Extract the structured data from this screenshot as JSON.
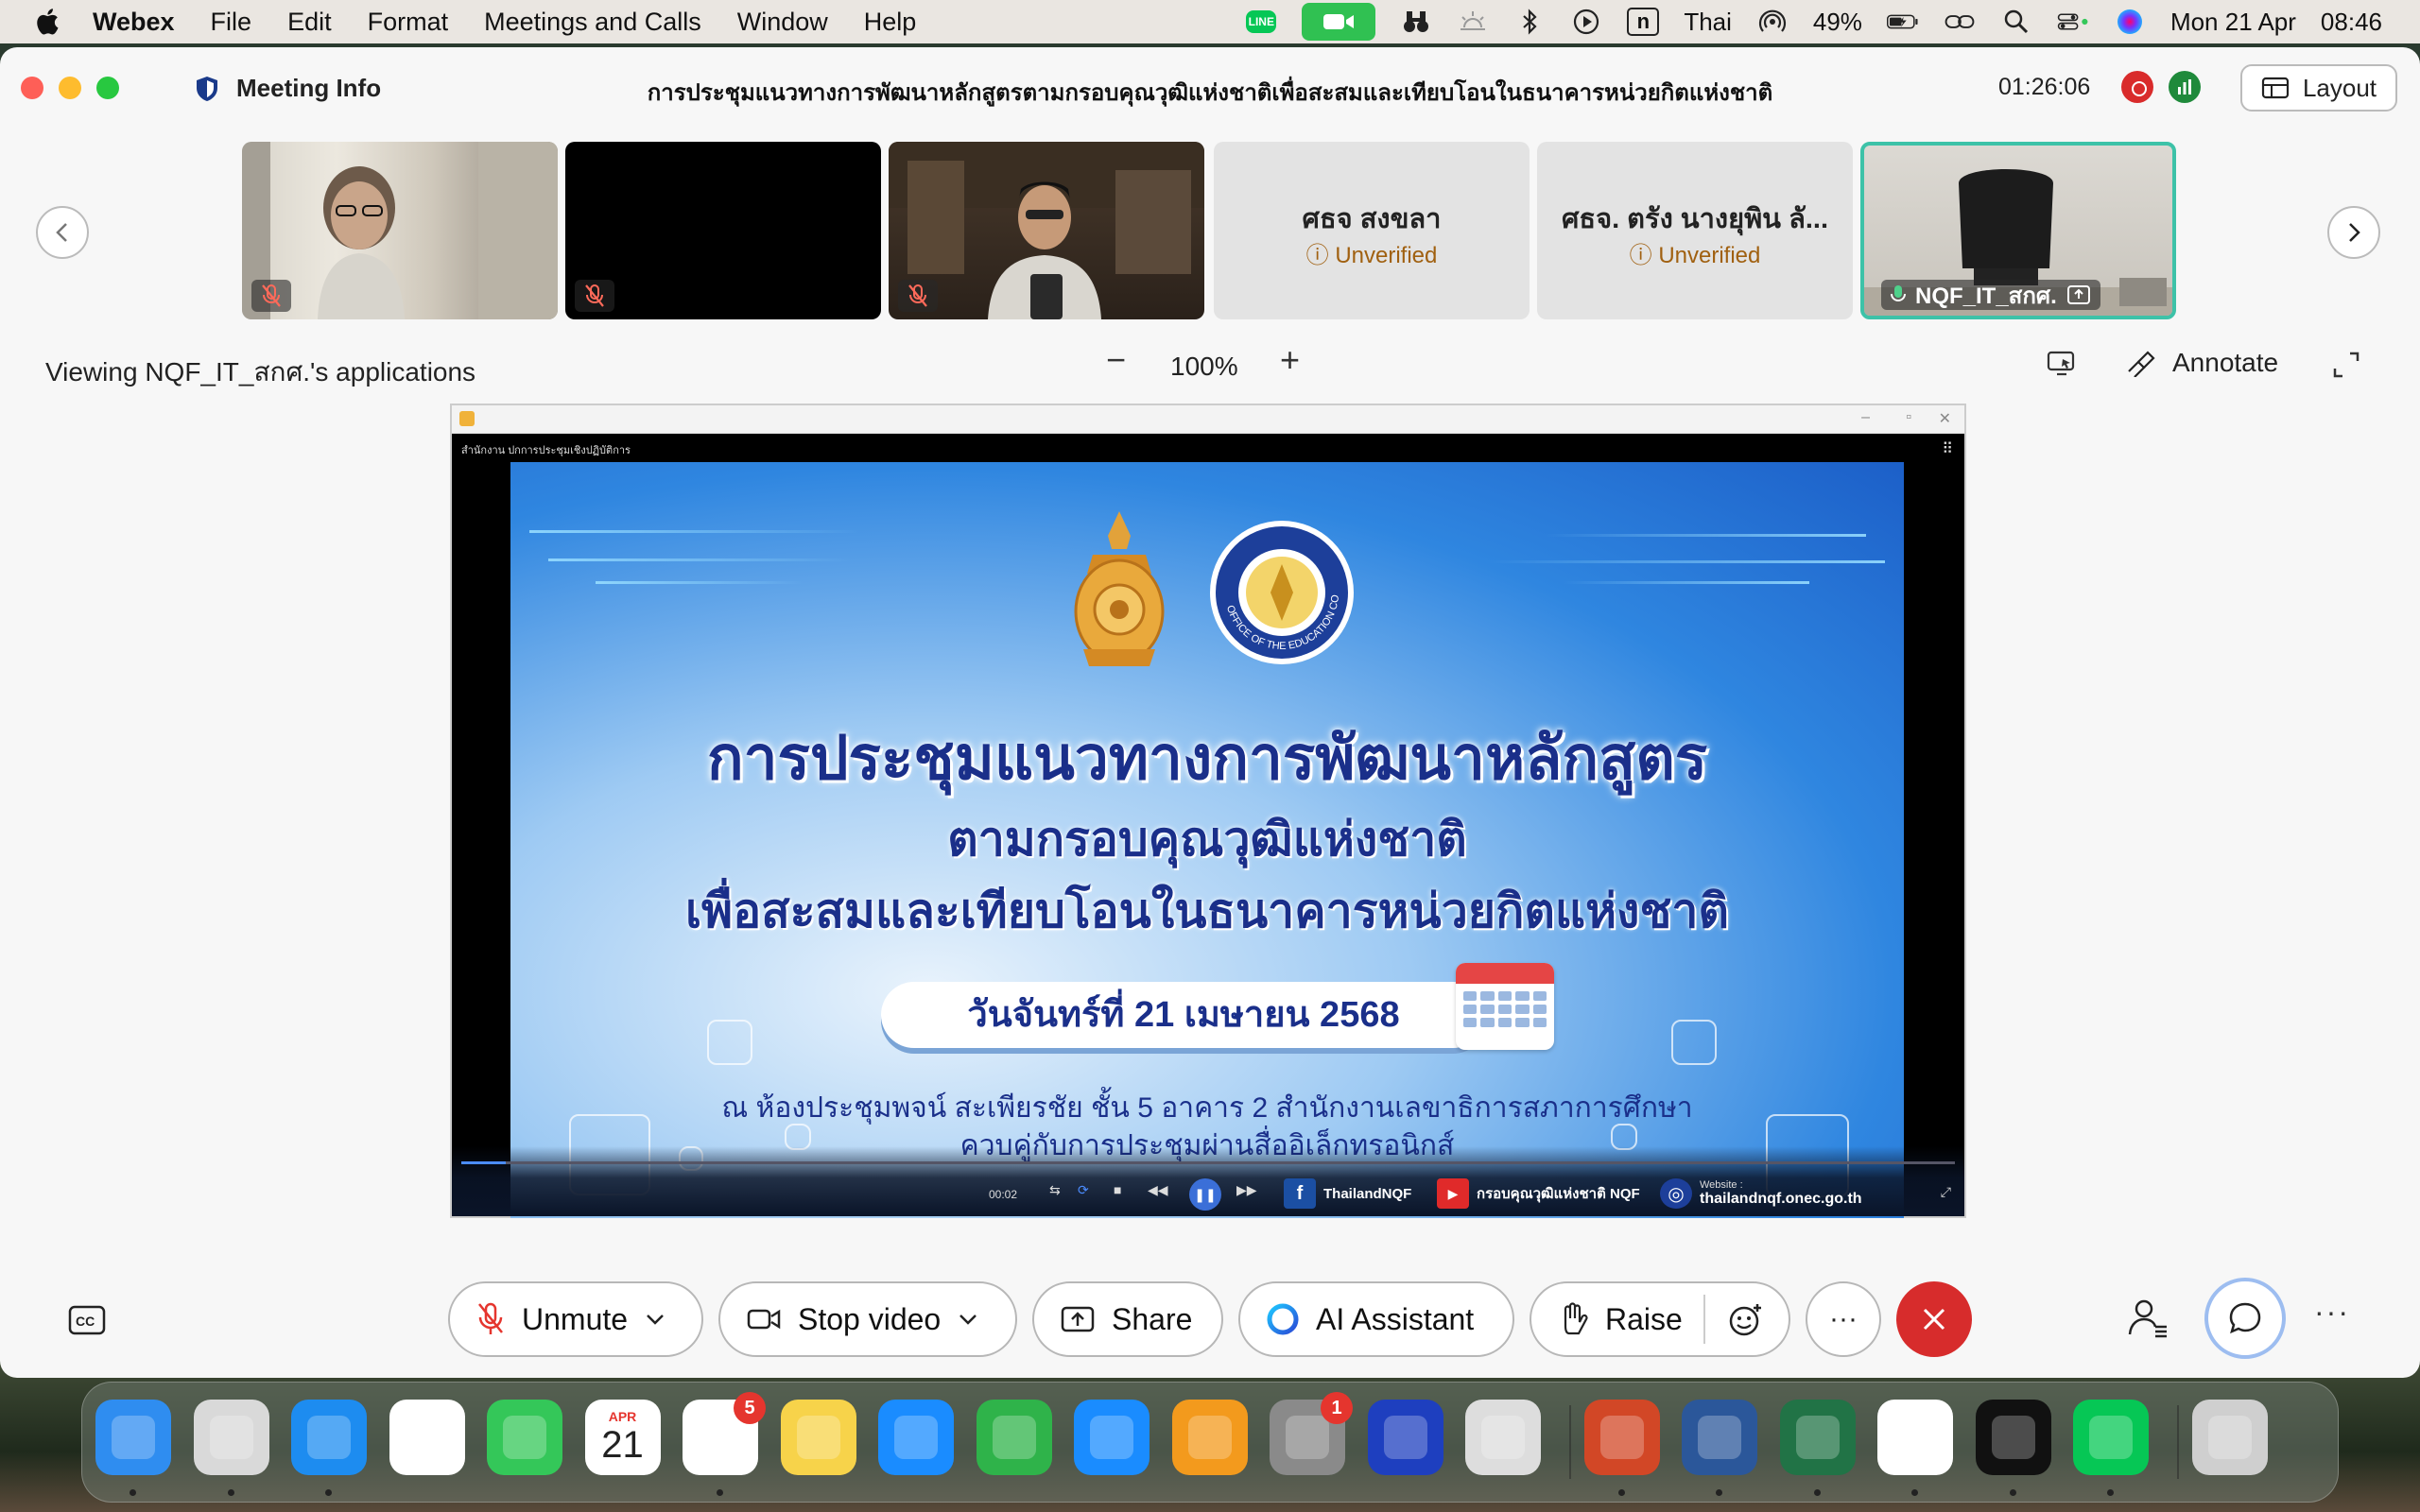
{
  "menubar": {
    "app_name": "Webex",
    "items": [
      "File",
      "Edit",
      "Format",
      "Meetings and Calls",
      "Window",
      "Help"
    ],
    "status": {
      "line_label": "LINE",
      "n_label": "n",
      "input_language": "Thai",
      "battery": "49%",
      "date": "Mon 21 Apr",
      "time": "08:46"
    }
  },
  "window": {
    "meeting_info_label": "Meeting Info",
    "meeting_title": "การประชุมแนวทางการพัฒนาหลักสูตรตามกรอบคุณวุฒิแห่งชาติเพื่อสะสมและเทียบโอนในธนาคารหน่วยกิตแห่งชาติ",
    "timer": "01:26:06",
    "layout_label": "Layout",
    "record_label": "O"
  },
  "participants": [
    {
      "type": "video",
      "muted": true
    },
    {
      "type": "black",
      "muted": true
    },
    {
      "type": "video",
      "muted": true
    },
    {
      "type": "name",
      "name": "ศธจ สงขลา",
      "status": "Unverified"
    },
    {
      "type": "name",
      "name": "ศธจ. ตรัง นางยุพิน ลั...",
      "status": "Unverified"
    },
    {
      "type": "video",
      "name": "NQF_IT_สกศ.",
      "active": true
    }
  ],
  "viewing": {
    "label": "Viewing NQF_IT_สกศ.'s applications",
    "zoom": "100%",
    "annotate_label": "Annotate"
  },
  "shared_content": {
    "video_window_title": "สำนักงาน ปกการประชุมเชิงปฏิบัติการ",
    "slide": {
      "emblem_text": "OFFICE OF THE EDUCATION COUNCIL",
      "line1": "การประชุมแนวทางการพัฒนาหลักสูตร",
      "line2": "ตามกรอบคุณวุฒิแห่งชาติ",
      "line3": "เพื่อสะสมและเทียบโอนในธนาคารหน่วยกิตแห่งชาติ",
      "date": "วันจันทร์ที่ 21 เมษายน 2568",
      "location1": "ณ ห้องประชุมพจน์ สะเพียรชัย ชั้น 5 อาคาร 2 สำนักงานเลขาธิการสภาการศึกษา",
      "location2": "ควบคู่กับการประชุมผ่านสื่ออิเล็กทรอนิกส์"
    },
    "player": {
      "time": "00:02",
      "progress_fraction": 0.03,
      "facebook_label": "ThailandNQF",
      "youtube_label": "กรอบคุณวุฒิแห่งชาติ NQF",
      "website_caption": "Website :",
      "website": "thailandnqf.onec.go.th"
    }
  },
  "toolbar": {
    "unmute_label": "Unmute",
    "stop_video_label": "Stop video",
    "share_label": "Share",
    "ai_assistant_label": "AI Assistant",
    "raise_label": "Raise",
    "more_label": "···"
  },
  "dock": {
    "apps": [
      {
        "name": "Finder",
        "color": "#2f8df0",
        "running": true
      },
      {
        "name": "Launchpad",
        "color": "#d9d9d9",
        "running": true
      },
      {
        "name": "Safari",
        "color": "#1d8cf0",
        "running": true
      },
      {
        "name": "Photos",
        "color": "#ffffff",
        "running": false
      },
      {
        "name": "FaceTime",
        "color": "#34c759",
        "running": false
      },
      {
        "name": "Calendar",
        "color": "#ffffff",
        "running": false,
        "month": "APR",
        "day": "21"
      },
      {
        "name": "Reminders",
        "color": "#ffffff",
        "running": true,
        "badge": "5"
      },
      {
        "name": "Notes",
        "color": "#f7d34a",
        "running": false
      },
      {
        "name": "Keynote",
        "color": "#1a8cff",
        "running": false
      },
      {
        "name": "Numbers",
        "color": "#2fb34a",
        "running": false
      },
      {
        "name": "App Store",
        "color": "#1a8cff",
        "running": false
      },
      {
        "name": "Pages",
        "color": "#f39a1d",
        "running": false
      },
      {
        "name": "System Settings",
        "color": "#8a8a8a",
        "running": false,
        "badge": "1"
      },
      {
        "name": "Screen Mirroring",
        "color": "#1e3fbf",
        "running": false
      },
      {
        "name": "iPhone Mirroring",
        "color": "#dddddd",
        "running": false
      },
      {
        "name": "PowerPoint",
        "color": "#d24726",
        "running": true
      },
      {
        "name": "Word",
        "color": "#2b579a",
        "running": true
      },
      {
        "name": "Excel",
        "color": "#217346",
        "running": true
      },
      {
        "name": "Chrome",
        "color": "#ffffff",
        "running": true
      },
      {
        "name": "Webex",
        "color": "#111111",
        "running": true
      },
      {
        "name": "LINE",
        "color": "#06c755",
        "running": true
      },
      {
        "name": "Trash",
        "color": "#cfcfcf",
        "running": false
      }
    ]
  }
}
